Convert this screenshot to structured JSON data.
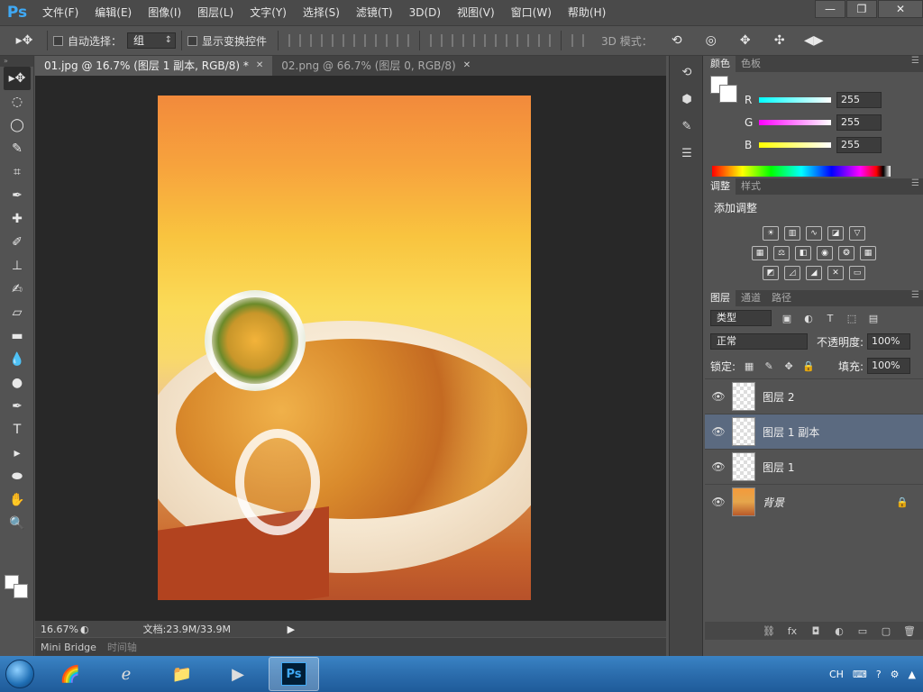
{
  "menu": {
    "logo": "Ps",
    "items": [
      "文件(F)",
      "编辑(E)",
      "图像(I)",
      "图层(L)",
      "文字(Y)",
      "选择(S)",
      "滤镜(T)",
      "3D(D)",
      "视图(V)",
      "窗口(W)",
      "帮助(H)"
    ]
  },
  "window_controls": {
    "minimize": "—",
    "restore": "❐",
    "close": "✕"
  },
  "options": {
    "auto_select_label": "自动选择：",
    "auto_select_value": "组",
    "show_transform_label": "显示变换控件",
    "mode_3d_label": "3D 模式："
  },
  "tabs": [
    {
      "label": "01.jpg @ 16.7% (图层 1 副本, RGB/8) *",
      "close": "✕"
    },
    {
      "label": "02.png @ 66.7% (图层 0, RGB/8)",
      "close": "✕"
    }
  ],
  "status": {
    "zoom": "16.67%",
    "doc_info": "文档:23.9M/33.9M",
    "arrow": "▶"
  },
  "mini_tabs": [
    "Mini Bridge",
    "时间轴"
  ],
  "color_panel": {
    "tabs": [
      "颜色",
      "色板"
    ],
    "sliders": [
      {
        "label": "R",
        "value": "255",
        "gradient": "linear-gradient(90deg, #00ffff, #ffffff)"
      },
      {
        "label": "G",
        "value": "255",
        "gradient": "linear-gradient(90deg, #ff00ff, #ffffff)"
      },
      {
        "label": "B",
        "value": "255",
        "gradient": "linear-gradient(90deg, #ffff00, #ffffff)"
      }
    ]
  },
  "adjust_panel": {
    "tabs": [
      "调整",
      "样式"
    ],
    "title": "添加调整"
  },
  "layers_panel": {
    "tabs": [
      "图层",
      "通道",
      "路径"
    ],
    "kind_label": "类型",
    "blend_mode": "正常",
    "opacity_label": "不透明度:",
    "opacity_value": "100%",
    "lock_label": "锁定:",
    "fill_label": "填充:",
    "fill_value": "100%",
    "layers": [
      {
        "name": "图层 2"
      },
      {
        "name": "图层 1 副本"
      },
      {
        "name": "图层 1"
      },
      {
        "name": "背景"
      }
    ]
  },
  "taskbar": {
    "tray": {
      "lang": "CH"
    }
  }
}
